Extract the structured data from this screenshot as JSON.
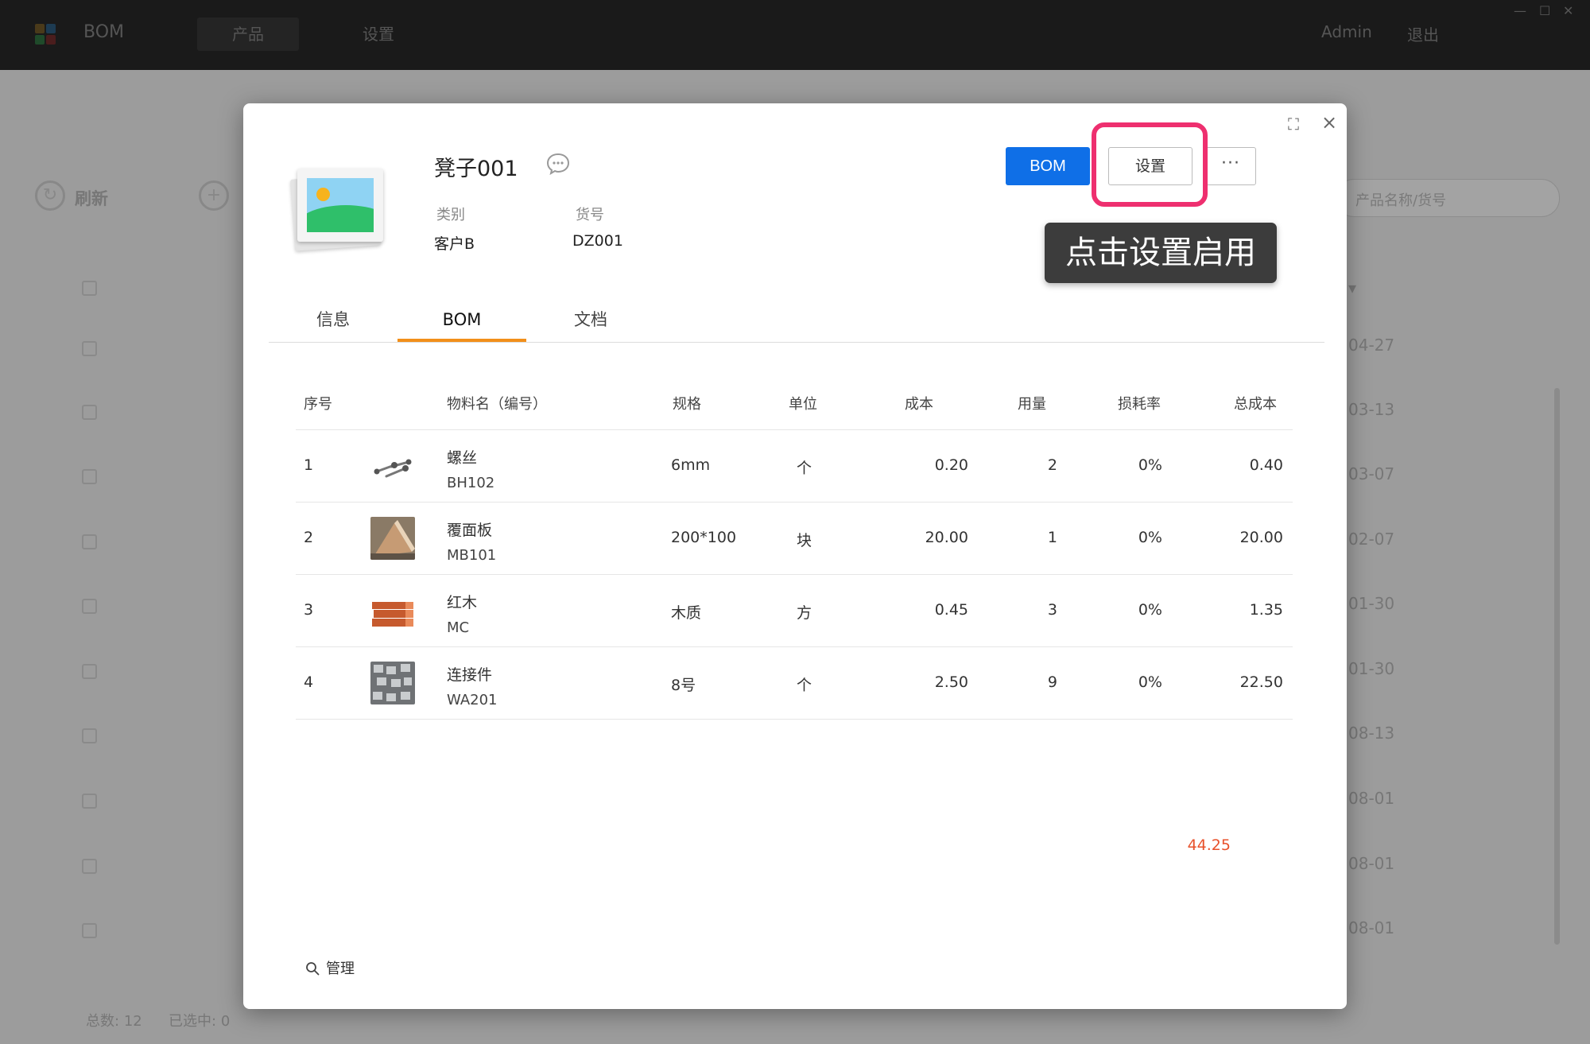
{
  "app": {
    "title": "BOM",
    "nav": [
      {
        "label": "产品"
      },
      {
        "label": "设置"
      }
    ],
    "user": "Admin",
    "logout": "退出",
    "window_controls": [
      "—",
      "☐",
      "✕"
    ]
  },
  "background": {
    "refresh_label": "刷新",
    "search_placeholder": "产品名称/货号",
    "dates": [
      "04-27",
      "03-13",
      "03-07",
      "02-07",
      "01-30",
      "01-30",
      "08-13",
      "08-01",
      "08-01",
      "08-01"
    ],
    "footer_total_label": "总数:",
    "footer_total": "12",
    "footer_selected_label": "已选中:",
    "footer_selected": "0"
  },
  "product": {
    "name": "凳子001",
    "category_label": "类别",
    "category_value": "客户B",
    "sku_label": "货号",
    "sku_value": "DZ001"
  },
  "actions": {
    "bom": "BOM",
    "settings": "设置",
    "more": "···"
  },
  "tooltip": "点击设置启用",
  "tabs": [
    {
      "label": "信息",
      "active": false
    },
    {
      "label": "BOM",
      "active": true
    },
    {
      "label": "文档",
      "active": false
    }
  ],
  "table": {
    "headers": {
      "no": "序号",
      "material": "物料名（编号）",
      "spec": "规格",
      "unit": "单位",
      "cost": "成本",
      "qty": "用量",
      "loss": "损耗率",
      "total": "总成本"
    },
    "rows": [
      {
        "no": "1",
        "name": "螺丝",
        "code": "BH102",
        "spec": "6mm",
        "unit": "个",
        "cost": "0.20",
        "qty": "2",
        "loss": "0%",
        "total": "0.40"
      },
      {
        "no": "2",
        "name": "覆面板",
        "code": "MB101",
        "spec": "200*100",
        "unit": "块",
        "cost": "20.00",
        "qty": "1",
        "loss": "0%",
        "total": "20.00"
      },
      {
        "no": "3",
        "name": "红木",
        "code": "MC",
        "spec": "木质",
        "unit": "方",
        "cost": "0.45",
        "qty": "3",
        "loss": "0%",
        "total": "1.35"
      },
      {
        "no": "4",
        "name": "连接件",
        "code": "WA201",
        "spec": "8号",
        "unit": "个",
        "cost": "2.50",
        "qty": "9",
        "loss": "0%",
        "total": "22.50"
      }
    ],
    "grand_total": "44.25"
  },
  "footer": {
    "manage": "管理"
  },
  "colors": {
    "primary": "#0f6fe7",
    "highlight": "#ee2f6f",
    "tab_underline": "#f28f1a",
    "total": "#e8512b"
  }
}
